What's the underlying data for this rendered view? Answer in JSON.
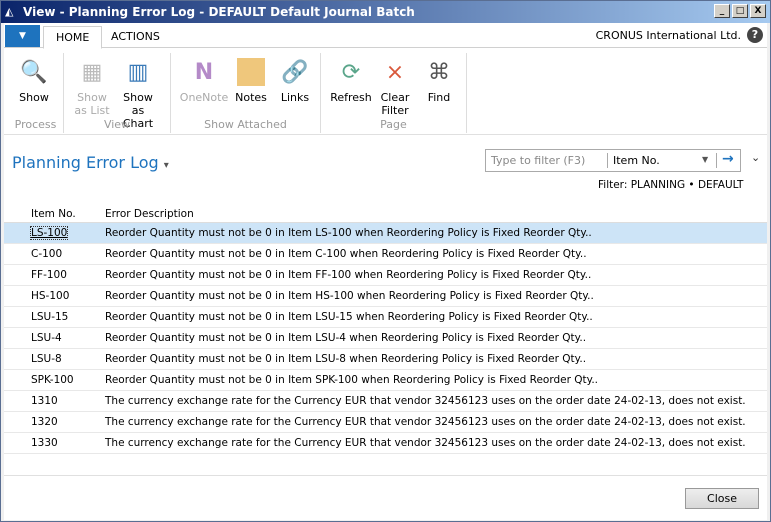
{
  "window": {
    "title": "View - Planning Error Log - DEFAULT Default Journal Batch",
    "min": "_",
    "max": "□",
    "close": "X"
  },
  "tabs": {
    "home": "HOME",
    "actions": "ACTIONS"
  },
  "company": "CRONUS International Ltd.",
  "help": "?",
  "ribbon": {
    "groups": [
      {
        "label": "Process"
      },
      {
        "label": "View"
      },
      {
        "label": "Show Attached"
      },
      {
        "label": "Page"
      }
    ],
    "show": "Show",
    "show_as_list": "Show as List",
    "show_as_chart": "Show as Chart",
    "onenote": "OneNote",
    "notes": "Notes",
    "links": "Links",
    "refresh": "Refresh",
    "clear_filter": "Clear Filter",
    "find": "Find"
  },
  "page": {
    "title": "Planning Error Log",
    "title_arrow": "▾"
  },
  "filter": {
    "placeholder": "Type to filter (F3)",
    "field": "Item No.",
    "applied": "Filter: PLANNING • DEFAULT"
  },
  "table": {
    "headers": [
      "Item No.",
      "Error Description"
    ],
    "rows": [
      [
        "LS-100",
        "Reorder Quantity must not be 0 in Item LS-100 when Reordering Policy is Fixed Reorder Qty.."
      ],
      [
        "C-100",
        "Reorder Quantity must not be 0 in Item C-100 when Reordering Policy is Fixed Reorder Qty.."
      ],
      [
        "FF-100",
        "Reorder Quantity must not be 0 in Item FF-100 when Reordering Policy is Fixed Reorder Qty.."
      ],
      [
        "HS-100",
        "Reorder Quantity must not be 0 in Item HS-100 when Reordering Policy is Fixed Reorder Qty.."
      ],
      [
        "LSU-15",
        "Reorder Quantity must not be 0 in Item LSU-15 when Reordering Policy is Fixed Reorder Qty.."
      ],
      [
        "LSU-4",
        "Reorder Quantity must not be 0 in Item LSU-4 when Reordering Policy is Fixed Reorder Qty.."
      ],
      [
        "LSU-8",
        "Reorder Quantity must not be 0 in Item LSU-8 when Reordering Policy is Fixed Reorder Qty.."
      ],
      [
        "SPK-100",
        "Reorder Quantity must not be 0 in Item SPK-100 when Reordering Policy is Fixed Reorder Qty.."
      ],
      [
        "1310",
        "The currency exchange rate for the Currency EUR that vendor 32456123 uses on the order date 24-02-13, does not exist."
      ],
      [
        "1320",
        "The currency exchange rate for the Currency EUR that vendor 32456123 uses on the order date 24-02-13, does not exist."
      ],
      [
        "1330",
        "The currency exchange rate for the Currency EUR that vendor 32456123 uses on the order date 24-02-13, does not exist."
      ]
    ]
  },
  "close_button": "Close"
}
